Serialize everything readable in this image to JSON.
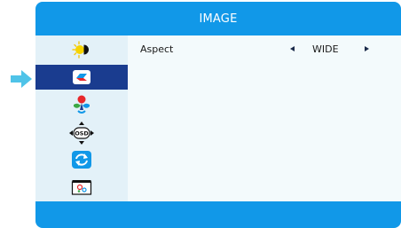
{
  "header": {
    "title": "IMAGE"
  },
  "sidebar": {
    "items": [
      {
        "icon": "brightness-contrast-icon",
        "selected": false
      },
      {
        "icon": "image-icon",
        "selected": true
      },
      {
        "icon": "color-icon",
        "selected": false
      },
      {
        "icon": "osd-settings-icon",
        "selected": false
      },
      {
        "icon": "reset-icon",
        "selected": false
      },
      {
        "icon": "extra-settings-icon",
        "selected": false
      }
    ]
  },
  "content": {
    "rows": [
      {
        "label": "Aspect",
        "value": "WIDE"
      }
    ]
  },
  "colors": {
    "header": "#1198e8",
    "footer": "#1198e8",
    "sidebar": "#e3f1f8",
    "selected": "#1a3c8f",
    "content": "#f3fafc",
    "pointer": "#4fc3e8"
  }
}
